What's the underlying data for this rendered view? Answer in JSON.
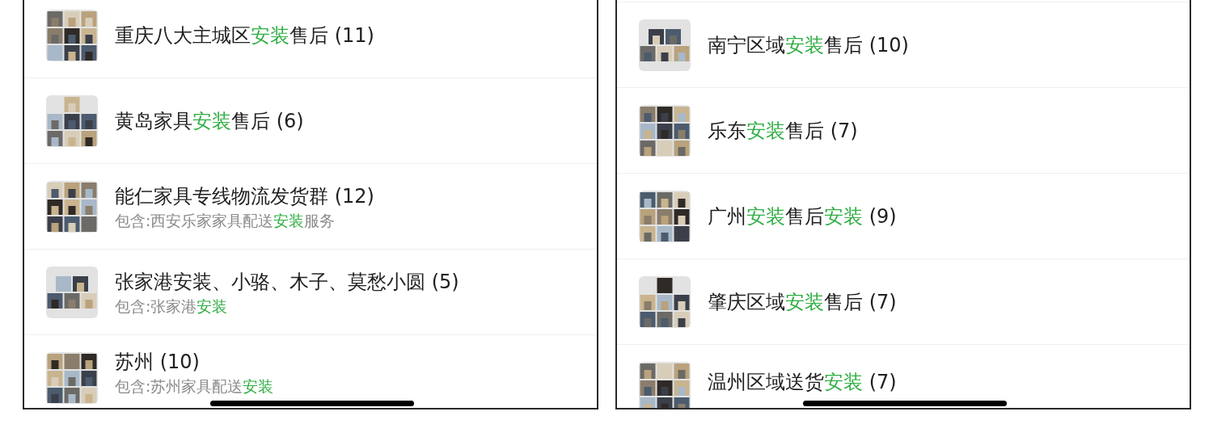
{
  "panels": [
    {
      "groups": [
        {
          "name": [
            {
              "text": "重庆八大主城区",
              "match": false
            },
            {
              "text": "安装",
              "match": true
            },
            {
              "text": "售后 (11)",
              "match": false
            }
          ]
        },
        {
          "name": [
            {
              "text": "黄岛家具",
              "match": false
            },
            {
              "text": "安装",
              "match": true
            },
            {
              "text": "售后 (6)",
              "match": false
            }
          ]
        },
        {
          "name": [
            {
              "text": "能仁家具专线物流发货群 (12)",
              "match": false
            }
          ],
          "subtitle": [
            {
              "text": "包含:西安乐家家具配送",
              "match": false
            },
            {
              "text": "安装",
              "match": true
            },
            {
              "text": "服务",
              "match": false
            }
          ]
        },
        {
          "name": [
            {
              "text": "张家港安装、小骆、木子、莫愁小圆 (5)",
              "match": false
            }
          ],
          "subtitle": [
            {
              "text": "包含:张家港",
              "match": false
            },
            {
              "text": "安装",
              "match": true
            }
          ]
        },
        {
          "name": [
            {
              "text": "苏州 (10)",
              "match": false
            }
          ],
          "subtitle": [
            {
              "text": "包含:苏州家具配送",
              "match": false
            },
            {
              "text": "安装",
              "match": true
            }
          ]
        }
      ]
    },
    {
      "groups": [
        {
          "name": [
            {
              "text": "南宁区域",
              "match": false
            },
            {
              "text": "安装",
              "match": true
            },
            {
              "text": "售后 (10)",
              "match": false
            }
          ]
        },
        {
          "name": [
            {
              "text": "乐东",
              "match": false
            },
            {
              "text": "安装",
              "match": true
            },
            {
              "text": "售后 (7)",
              "match": false
            }
          ]
        },
        {
          "name": [
            {
              "text": "广州",
              "match": false
            },
            {
              "text": "安装",
              "match": true
            },
            {
              "text": "售后",
              "match": false
            },
            {
              "text": "安装",
              "match": true
            },
            {
              "text": " (9)",
              "match": false
            }
          ]
        },
        {
          "name": [
            {
              "text": "肇庆区域",
              "match": false
            },
            {
              "text": "安装",
              "match": true
            },
            {
              "text": "售后 (7)",
              "match": false
            }
          ]
        },
        {
          "name": [
            {
              "text": "温州区域送货",
              "match": false
            },
            {
              "text": "安装",
              "match": true
            },
            {
              "text": " (7)",
              "match": false
            }
          ]
        }
      ]
    }
  ]
}
